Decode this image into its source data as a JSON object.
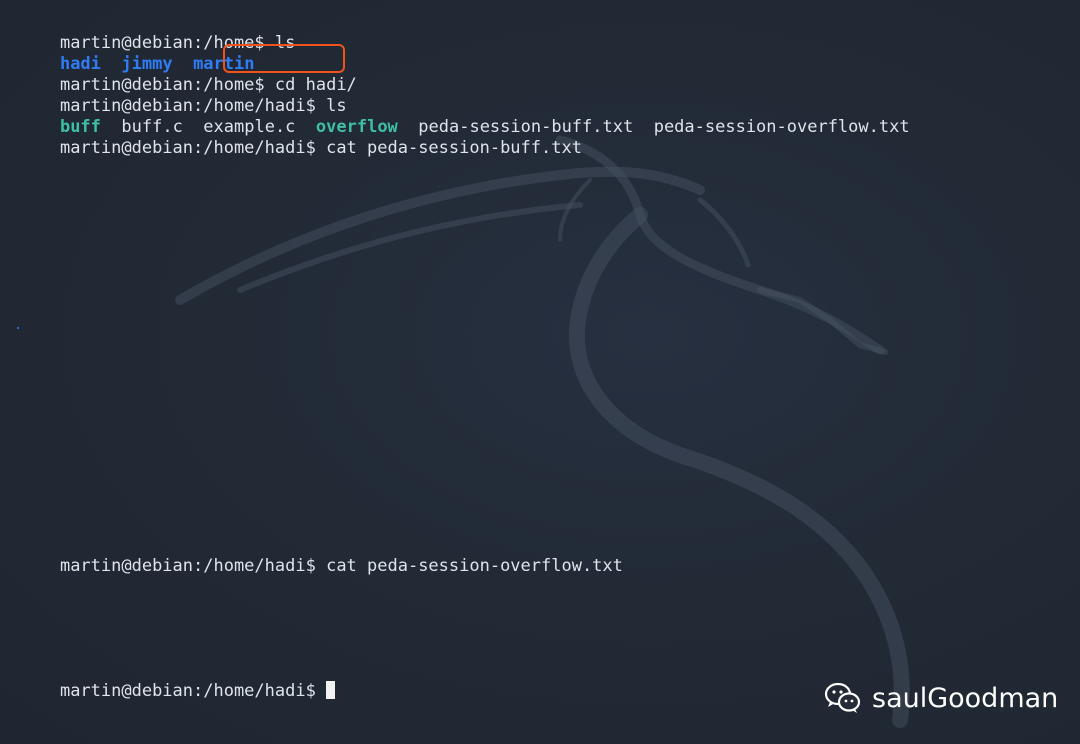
{
  "terminal": {
    "lines": [
      {
        "prompt": "martin@debian:/home$",
        "command": "ls"
      },
      {
        "listing": [
          "hadi",
          "jimmy",
          "martin"
        ]
      },
      {
        "prompt": "martin@debian:/home$",
        "command": "cd hadi/"
      },
      {
        "prompt": "martin@debian:/home/hadi$",
        "command": "ls"
      },
      {
        "listing": [
          "buff",
          "buff.c",
          "example.c",
          "overflow",
          "peda-session-buff.txt",
          "peda-session-overflow.txt"
        ]
      },
      {
        "prompt": "martin@debian:/home/hadi$",
        "command": "cat peda-session-buff.txt"
      },
      {
        "prompt": "martin@debian:/home/hadi$",
        "command": "cat peda-session-overflow.txt"
      },
      {
        "prompt": "martin@debian:/home/hadi$",
        "command": ""
      }
    ]
  },
  "watermark": {
    "icon": "wechat-icon",
    "text": "saulGoodman"
  },
  "colors": {
    "background": "#212834",
    "text": "#dfe3ea",
    "directory": "#2f7cf6",
    "executable": "#3fbfa5",
    "highlight": "#f0531c"
  }
}
